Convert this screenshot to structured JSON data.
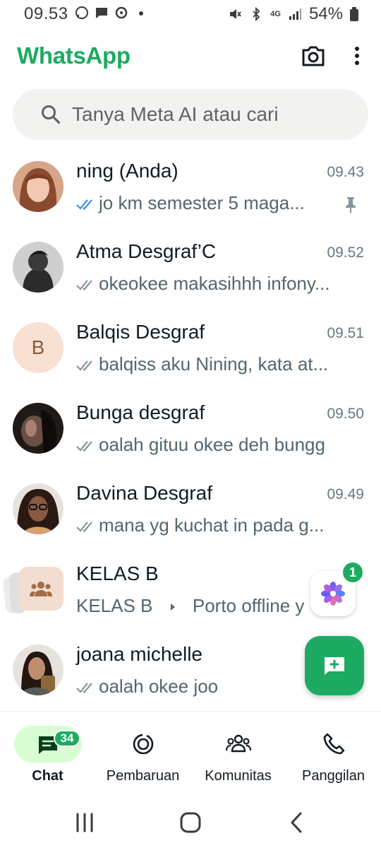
{
  "status_bar": {
    "time": "09.53",
    "network": "4G",
    "battery": "54%"
  },
  "header": {
    "title": "WhatsApp",
    "brand_color": "#1DAA61"
  },
  "search": {
    "placeholder": "Tanya Meta AI atau cari"
  },
  "chats": [
    {
      "name": "ning (Anda)",
      "time": "09.43",
      "message": "jo km semester 5 maga...",
      "tick": "read",
      "pinned": true
    },
    {
      "name": "Atma Desgraf’C",
      "time": "09.52",
      "message": "okeokee makasihhh infony...",
      "tick": "delivered"
    },
    {
      "name": "Balqis Desgraf",
      "time": "09.51",
      "message": "balqiss aku Nining, kata at...",
      "tick": "delivered",
      "avatar_letter": "B"
    },
    {
      "name": "Bunga desgraf",
      "time": "09.50",
      "message": "oalah gituu okee deh bungg",
      "tick": "delivered"
    },
    {
      "name": "Davina Desgraf",
      "time": "09.49",
      "message": "mana yg kuchat in pada g...",
      "tick": "delivered"
    },
    {
      "name": "KELAS B",
      "sub_group": "KELAS B",
      "message": "Porto offline y",
      "unread": "1"
    },
    {
      "name": "joana michelle",
      "message": "oalah okee joo",
      "tick": "delivered"
    }
  ],
  "bottom_nav": [
    {
      "label": "Chat",
      "badge": "34",
      "active": true
    },
    {
      "label": "Pembaruan"
    },
    {
      "label": "Komunitas"
    },
    {
      "label": "Panggilan"
    }
  ]
}
